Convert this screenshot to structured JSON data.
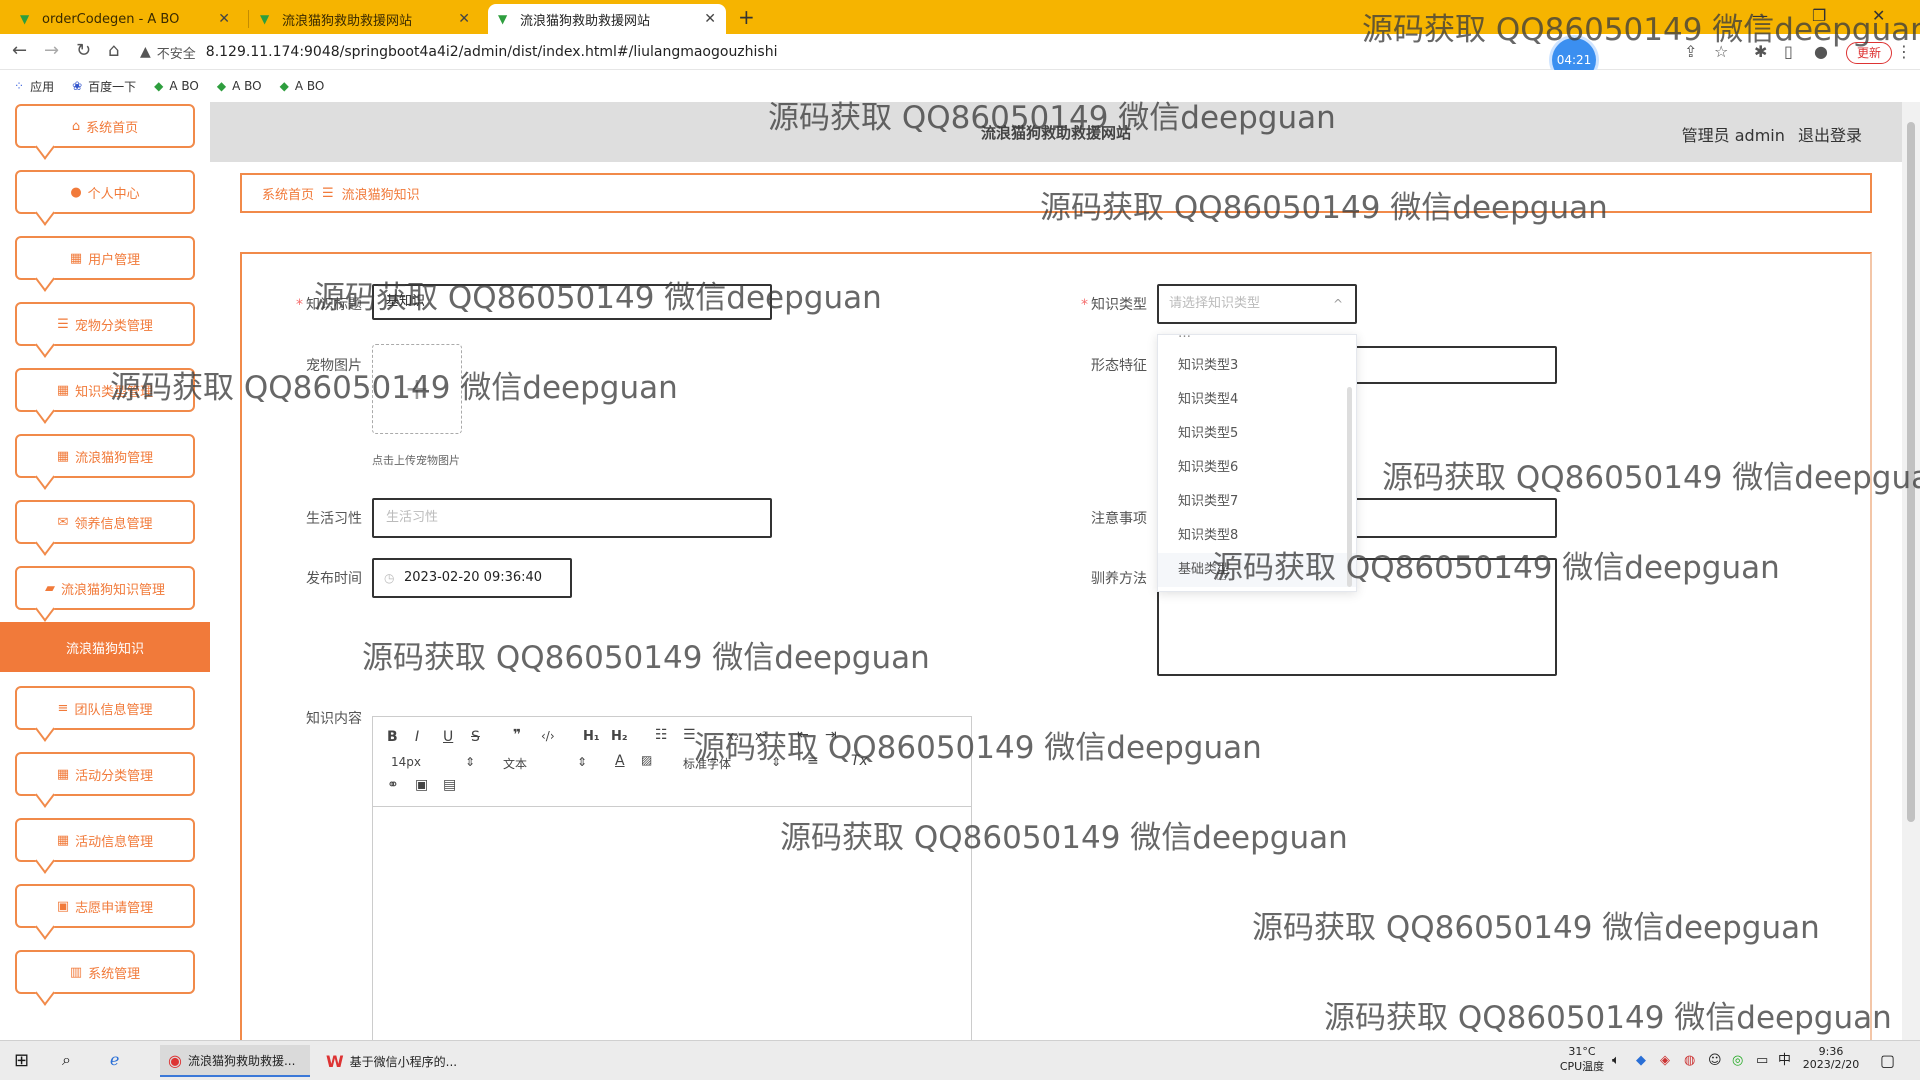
{
  "browser": {
    "tabs": [
      {
        "title": "orderCodegen - A BO",
        "active": false
      },
      {
        "title": "流浪猫狗救助救援网站",
        "active": false
      },
      {
        "title": "流浪猫狗救助救援网站",
        "active": true
      }
    ],
    "insecure_label": "不安全",
    "url": "8.129.11.174:9048/springboot4a4i2/admin/dist/index.html#/liulangmaogouzhishi",
    "clock": "04:21",
    "update_label": "更新",
    "bookmarks": [
      "应用",
      "百度一下",
      "A BO",
      "A BO",
      "A BO"
    ]
  },
  "header": {
    "site_title": "流浪猫狗救助救援网站",
    "role": "管理员 admin",
    "logout": "退出登录"
  },
  "sidebar": {
    "items": [
      {
        "label": "系统首页",
        "icon": "home-icon"
      },
      {
        "label": "个人中心",
        "icon": "user-icon"
      },
      {
        "label": "用户管理",
        "icon": "grid-icon"
      },
      {
        "label": "宠物分类管理",
        "icon": "list-icon"
      },
      {
        "label": "知识类型管理",
        "icon": "grid-icon"
      },
      {
        "label": "流浪猫狗管理",
        "icon": "grid-icon"
      },
      {
        "label": "领养信息管理",
        "icon": "ticket-icon"
      },
      {
        "label": "流浪猫狗知识管理",
        "icon": "book-icon"
      }
    ],
    "active_sub": "流浪猫狗知识",
    "items_after": [
      {
        "label": "团队信息管理",
        "icon": "sliders-icon"
      },
      {
        "label": "活动分类管理",
        "icon": "grid-icon"
      },
      {
        "label": "活动信息管理",
        "icon": "grid-icon"
      },
      {
        "label": "志愿申请管理",
        "icon": "clipboard-icon"
      },
      {
        "label": "系统管理",
        "icon": "chart-icon"
      }
    ]
  },
  "breadcrumb": {
    "home": "系统首页",
    "current": "流浪猫狗知识"
  },
  "form": {
    "title_label": "知识标题",
    "title_value": "基知识",
    "type_label": "知识类型",
    "type_placeholder": "请选择知识类型",
    "image_label": "宠物图片",
    "image_tip": "点击上传宠物图片",
    "shape_label": "形态特征",
    "habit_label": "生活习性",
    "habit_placeholder": "生活习性",
    "notice_label": "注意事项",
    "time_label": "发布时间",
    "time_value": "2023-02-20 09:36:40",
    "train_label": "驯养方法",
    "content_label": "知识内容"
  },
  "dropdown": {
    "options": [
      "知识类型3",
      "知识类型4",
      "知识类型5",
      "知识类型6",
      "知识类型7",
      "知识类型8",
      "基础类型"
    ]
  },
  "editor": {
    "font_size": "14px",
    "paragraph": "文本",
    "font_family": "标准字体"
  },
  "watermark": "源码获取 QQ86050149 微信deepguan",
  "taskbar": {
    "apps": [
      "流浪猫狗救助救援...",
      "基于微信小程序的..."
    ],
    "temperature": "31°C",
    "cpu": "CPU温度",
    "ime": "中",
    "time": "9:36",
    "date": "2023/2/20"
  },
  "colors": {
    "accent": "#f17a3a",
    "tabbar": "#f6b400",
    "header": "#dedede"
  }
}
